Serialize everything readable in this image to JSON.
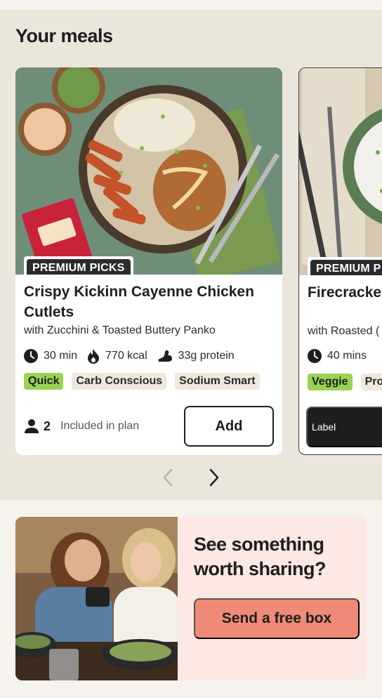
{
  "section": {
    "title": "Your meals"
  },
  "meals": [
    {
      "badge": "PREMIUM PICKS",
      "title": "Crispy Kickinn Cayenne Chicken Cutlets",
      "subtitle": "with Zucchini & Toasted Buttery Panko",
      "time": "30 min",
      "calories": "770 kcal",
      "protein": "33g protein",
      "tags": [
        "Quick",
        "Carb Conscious",
        "Sodium Smart"
      ],
      "servings": "2",
      "plan_text": "Included in plan",
      "action_label": "Add"
    },
    {
      "badge": "PREMIUM P",
      "title": "Firecracker Rice",
      "subtitle": "with Roasted (",
      "time": "40 mins",
      "tags": [
        "Veggie",
        "Pro"
      ],
      "action_label": "Label"
    }
  ],
  "pager": {
    "prev_icon": "chevron-left-icon",
    "next_icon": "chevron-right-icon"
  },
  "share": {
    "title": "See something worth sharing?",
    "button_label": "Send a free box"
  },
  "colors": {
    "section_bg": "#ebe6dc",
    "tag_green": "#9ad353",
    "tag_neutral": "#efe9dd",
    "share_bg": "#fde8e4",
    "share_button": "#ef8a78"
  }
}
